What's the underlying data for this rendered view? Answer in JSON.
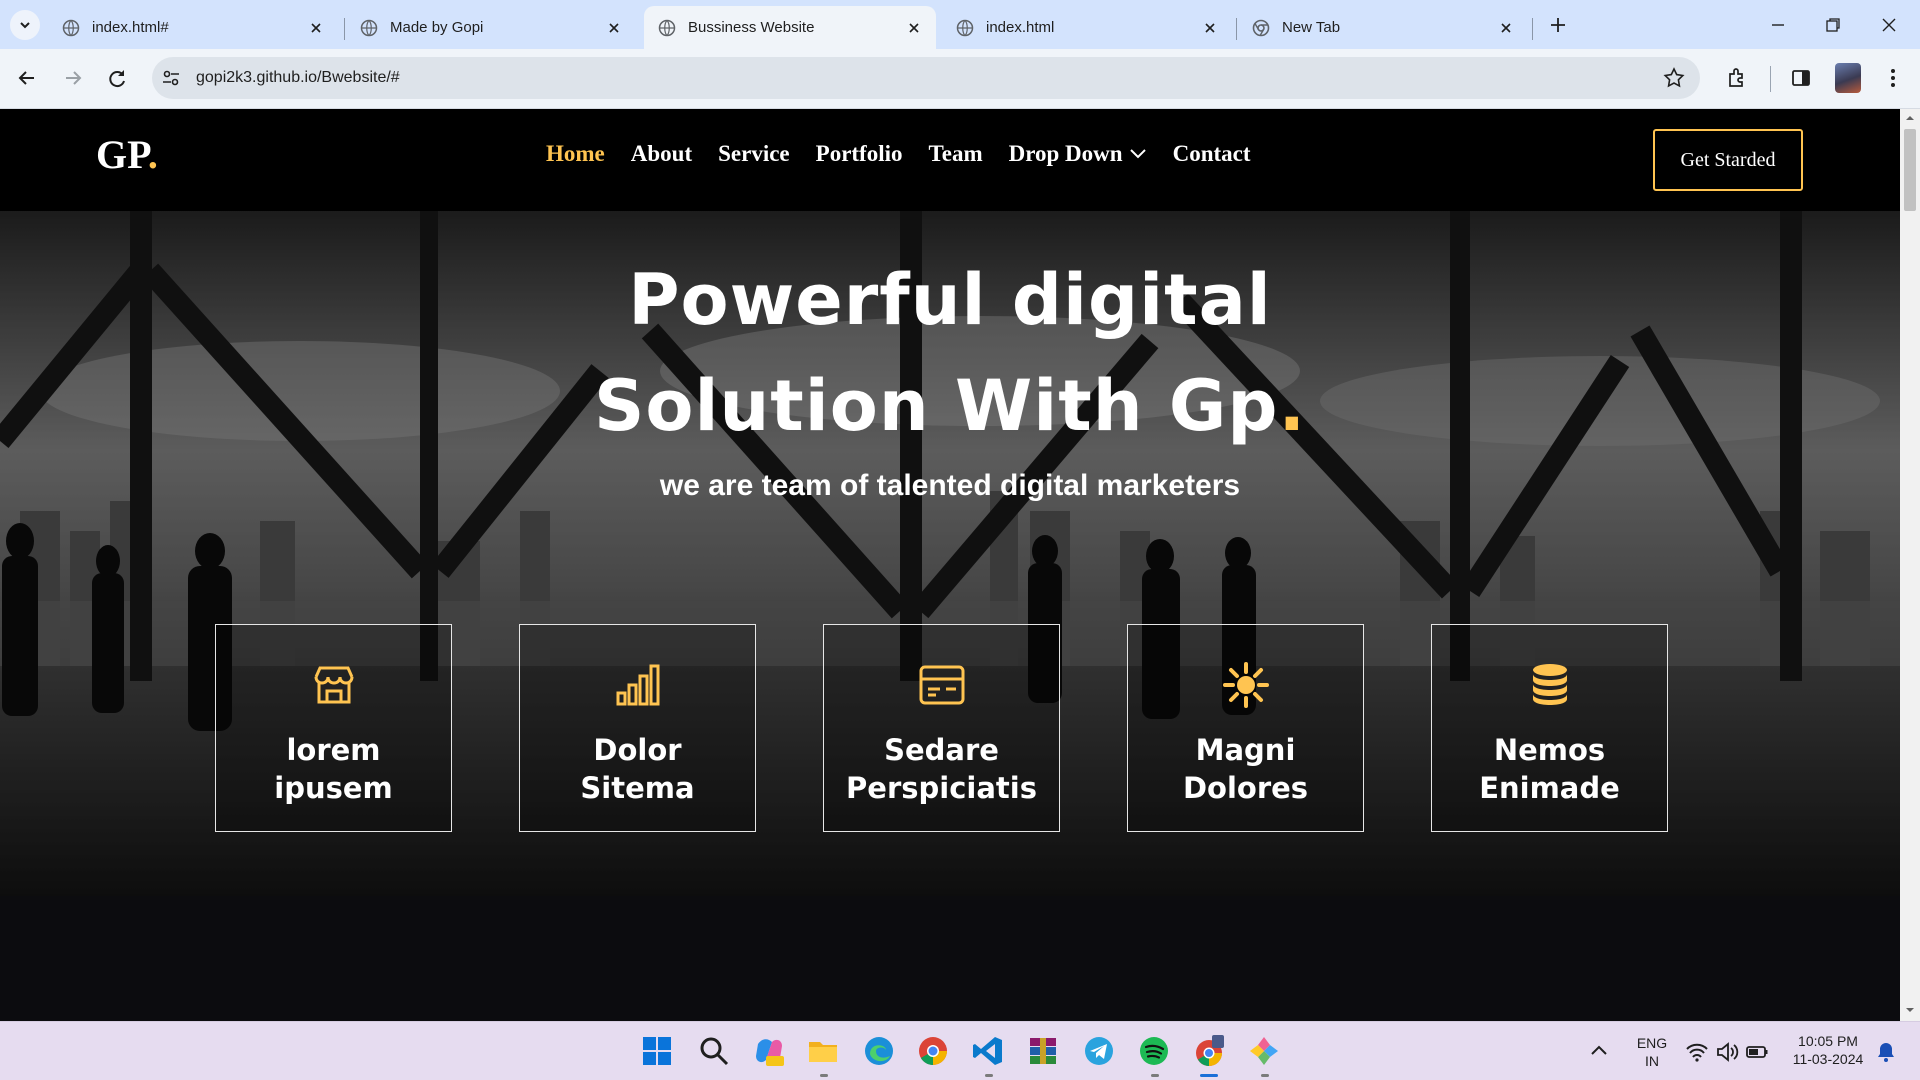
{
  "browser": {
    "tabs": [
      {
        "title": "index.html#",
        "active": false
      },
      {
        "title": "Made by Gopi",
        "active": false
      },
      {
        "title": "Bussiness Website",
        "active": true
      },
      {
        "title": "index.html",
        "active": false
      },
      {
        "title": "New Tab",
        "active": false
      }
    ],
    "url": "gopi2k3.github.io/Bwebsite/#"
  },
  "site": {
    "logo": "GP",
    "logo_dot": ".",
    "nav": [
      {
        "label": "Home",
        "active": true
      },
      {
        "label": "About"
      },
      {
        "label": "Service"
      },
      {
        "label": "Portfolio"
      },
      {
        "label": "Team"
      },
      {
        "label": "Drop Down"
      },
      {
        "label": "Contact"
      }
    ],
    "cta_label": "Get Starded",
    "hero": {
      "title_line1": "Powerful digital",
      "title_line2": "Solution With Gp",
      "title_dot": ".",
      "subtitle": "we are team of talented digital marketers"
    },
    "features": [
      {
        "icon": "store-icon",
        "label": "lorem ipusem"
      },
      {
        "icon": "bar-chart-icon",
        "label": "Dolor Sitema"
      },
      {
        "icon": "calendar-card-icon",
        "label": "Sedare Perspiciatis"
      },
      {
        "icon": "sun-gear-icon",
        "label": "Magni Dolores"
      },
      {
        "icon": "database-icon",
        "label": "Nemos Enimade"
      }
    ]
  },
  "taskbar": {
    "language": "ENG",
    "region": "IN",
    "time": "10:05 PM",
    "date": "11-03-2024"
  },
  "colors": {
    "accent": "#ffc451",
    "nav_bg": "#000000",
    "taskbar_bg": "#e6dcf0",
    "tab_strip_bg": "#d3e3fd"
  }
}
